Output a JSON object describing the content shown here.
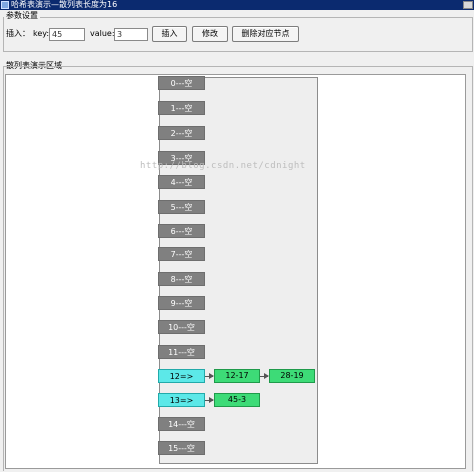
{
  "window": {
    "title": "哈希表演示—散列表长度为16"
  },
  "settings": {
    "legend": "参数设置",
    "insert_label": "插入：",
    "key_label": "key:",
    "key_value": "45",
    "value_label": "value:",
    "value_value": "3",
    "insert_button": "插入",
    "modify_button": "修改",
    "delete_button": "删除对应节点"
  },
  "demo": {
    "legend": "散列表演示区域",
    "watermark": "http://blog.csdn.net/cdnight",
    "slots": [
      {
        "label": "0---空",
        "filled": false
      },
      {
        "label": "1---空",
        "filled": false
      },
      {
        "label": "2---空",
        "filled": false
      },
      {
        "label": "3---空",
        "filled": false
      },
      {
        "label": "4---空",
        "filled": false
      },
      {
        "label": "5---空",
        "filled": false
      },
      {
        "label": "6---空",
        "filled": false
      },
      {
        "label": "7---空",
        "filled": false
      },
      {
        "label": "8---空",
        "filled": false
      },
      {
        "label": "9---空",
        "filled": false
      },
      {
        "label": "10---空",
        "filled": false
      },
      {
        "label": "11---空",
        "filled": false
      },
      {
        "label": "12=>",
        "filled": true,
        "nodes": [
          "12-17",
          "28-19"
        ]
      },
      {
        "label": "13=>",
        "filled": true,
        "nodes": [
          "45-3"
        ]
      },
      {
        "label": "14---空",
        "filled": false
      },
      {
        "label": "15---空",
        "filled": false
      }
    ]
  },
  "colors": {
    "empty_slot": "#808080",
    "active_slot": "#5ce8e8",
    "node": "#3ddb77",
    "title_bar": "#0b2a6f"
  }
}
